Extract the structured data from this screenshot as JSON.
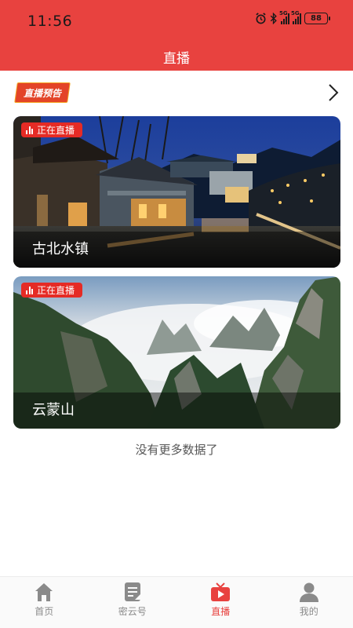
{
  "status_bar": {
    "time": "11:56",
    "signal_1_label": "5G",
    "signal_2_label": "5G",
    "battery": "88",
    "icons": [
      "alarm-icon",
      "bluetooth-icon",
      "signal-icon",
      "signal-icon",
      "battery-icon"
    ]
  },
  "header": {
    "title": "直播"
  },
  "preview": {
    "badge_label": "直播预告",
    "more_icon": "chevron-right-icon"
  },
  "streams": [
    {
      "status": "正在直播",
      "title": "古北水镇"
    },
    {
      "status": "正在直播",
      "title": "云蒙山"
    }
  ],
  "footer_message": "没有更多数据了",
  "tabs": [
    {
      "label": "首页",
      "icon": "home-icon",
      "active": false
    },
    {
      "label": "密云号",
      "icon": "document-icon",
      "active": false
    },
    {
      "label": "直播",
      "icon": "tv-icon",
      "active": true
    },
    {
      "label": "我的",
      "icon": "user-icon",
      "active": false
    }
  ],
  "colors": {
    "brand": "#e8423f",
    "live_badge": "#e52b25",
    "inactive_tab": "#8a8a8a"
  }
}
